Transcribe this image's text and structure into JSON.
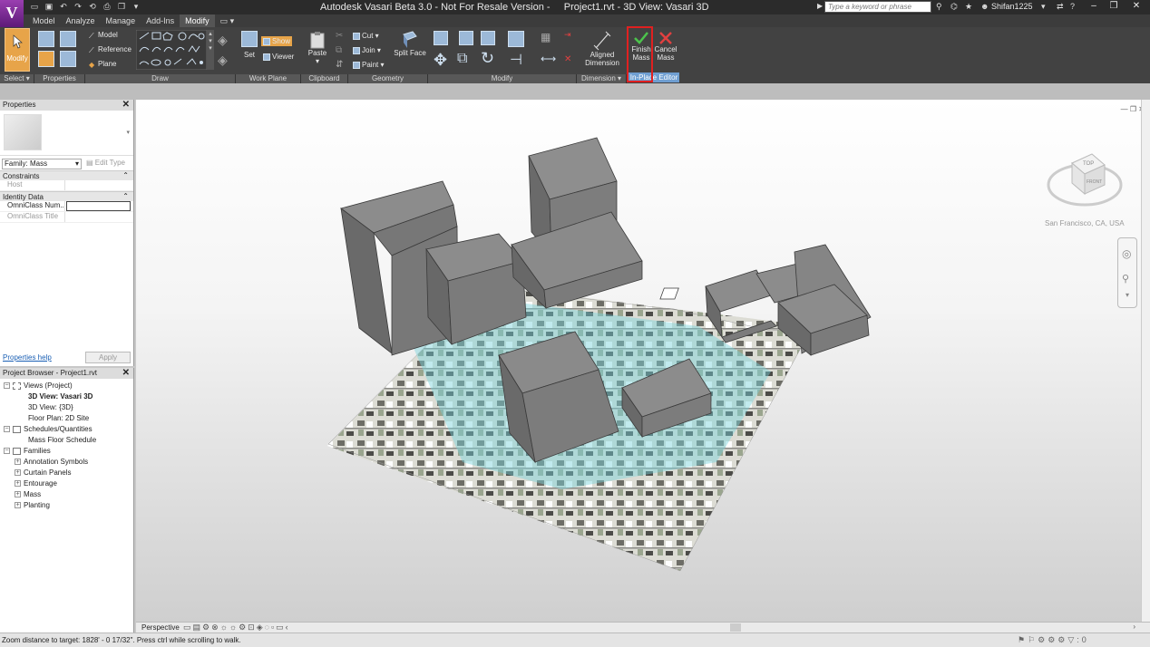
{
  "app": {
    "logo": "V",
    "title": "Autodesk Vasari Beta 3.0 - Not For Resale Version -     Project1.rvt - 3D View: Vasari 3D",
    "search_placeholder": "Type a keyword or phrase",
    "user": "Shifan1225"
  },
  "ribbon": {
    "tabs": [
      "Model",
      "Analyze",
      "Manage",
      "Add-Ins",
      "Modify"
    ],
    "active_tab": "Modify",
    "select": {
      "modify_label": "Modify",
      "panel_label": "Select"
    },
    "properties": {
      "panel_label": "Properties"
    },
    "draw": {
      "model_label": "Model",
      "reference_label": "Reference",
      "plane_label": "Plane",
      "panel_label": "Draw"
    },
    "work_plane": {
      "set_label": "Set",
      "show_label": "Show",
      "viewer_label": "Viewer",
      "panel_label": "Work Plane"
    },
    "clipboard": {
      "paste_label": "Paste",
      "panel_label": "Clipboard"
    },
    "geometry": {
      "cut_label": "Cut",
      "join_label": "Join",
      "paint_label": "Paint",
      "split_face_label": "Split Face",
      "panel_label": "Geometry"
    },
    "modify": {
      "panel_label": "Modify"
    },
    "dimension": {
      "aligned_label_1": "Aligned",
      "aligned_label_2": "Dimension",
      "panel_label": "Dimension"
    },
    "inplace": {
      "finish_label_1": "Finish",
      "finish_label_2": "Mass",
      "cancel_label_1": "Cancel",
      "cancel_label_2": "Mass",
      "panel_label": "In-Place Editor"
    }
  },
  "properties": {
    "title": "Properties",
    "family": "Family: Mass",
    "edit_type": "Edit Type",
    "sections": [
      {
        "name": "Constraints",
        "rows": [
          {
            "key": "Host",
            "value": ""
          }
        ]
      },
      {
        "name": "Identity Data",
        "rows": [
          {
            "key": "OmniClass Num...",
            "value": ""
          },
          {
            "key": "OmniClass Title",
            "value": ""
          }
        ]
      }
    ],
    "help": "Properties help",
    "apply": "Apply"
  },
  "browser": {
    "title": "Project Browser - Project1.rvt",
    "items": [
      {
        "label": "Views (Project)",
        "level": 0,
        "toggle": "−"
      },
      {
        "label": "3D View: Vasari 3D",
        "level": 1,
        "bold": true
      },
      {
        "label": "3D View: {3D}",
        "level": 1
      },
      {
        "label": "Floor Plan: 2D Site",
        "level": 1
      },
      {
        "label": "Schedules/Quantities",
        "level": 0,
        "toggle": "−"
      },
      {
        "label": "Mass Floor Schedule",
        "level": 1
      },
      {
        "label": "Families",
        "level": 0,
        "toggle": "−"
      },
      {
        "label": "Annotation Symbols",
        "level": 1,
        "toggle": "+"
      },
      {
        "label": "Curtain Panels",
        "level": 1,
        "toggle": "+"
      },
      {
        "label": "Entourage",
        "level": 1,
        "toggle": "+"
      },
      {
        "label": "Mass",
        "level": 1,
        "toggle": "+"
      },
      {
        "label": "Planting",
        "level": 1,
        "toggle": "+"
      }
    ]
  },
  "viewport": {
    "viewcube_top": "TOP",
    "viewcube_front": "FRONT",
    "location": "San Francisco, CA, USA"
  },
  "viewbar": {
    "mode": "Perspective"
  },
  "status": {
    "text": "Zoom distance to target: 1828' - 0 17/32\". Press ctrl while scrolling to walk.",
    "filter_count": ":0"
  },
  "colors": {
    "accent": "#e7a449",
    "highlight": "#e02020",
    "inplace": "#6f9ed1",
    "mass": "#7c7c7c"
  }
}
